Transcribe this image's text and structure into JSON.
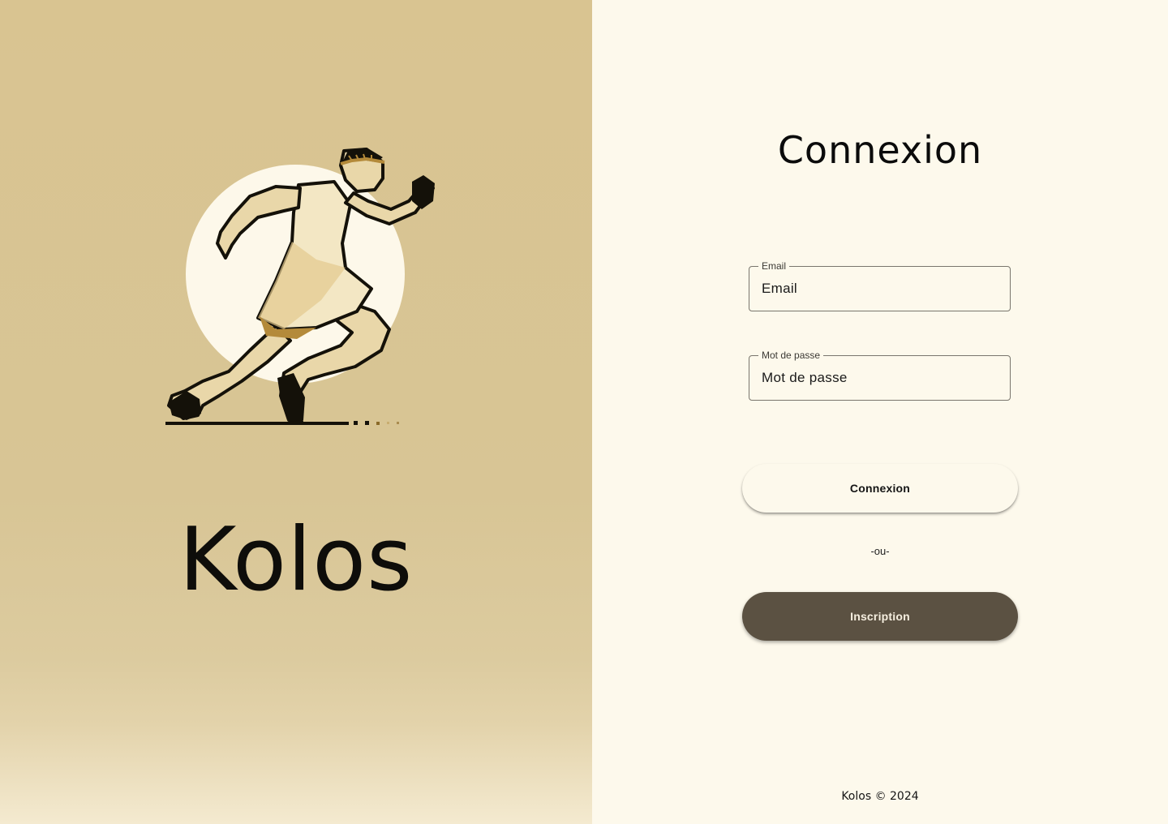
{
  "brand": {
    "name": "Kolos",
    "logo_icon": "greek-runner-icon",
    "background_color": "#d9c491"
  },
  "login_form": {
    "title": "Connexion",
    "email": {
      "label": "Email",
      "placeholder": "Email",
      "value": ""
    },
    "password": {
      "label": "Mot de passe",
      "placeholder": "Mot de passe",
      "value": ""
    },
    "login_button": "Connexion",
    "separator": "-ou-",
    "register_button": "Inscription"
  },
  "footer": {
    "text": "Kolos © 2024"
  },
  "colors": {
    "panel_background": "#fdf9ec",
    "primary_button": "#5b5142",
    "text": "#0e0d0a"
  }
}
